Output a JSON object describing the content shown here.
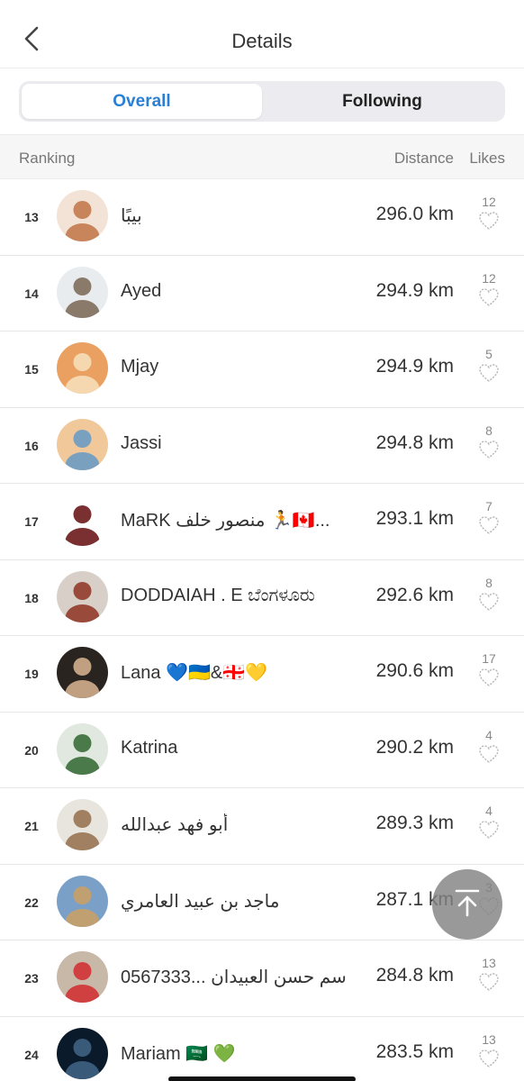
{
  "header": {
    "title": "Details",
    "back_icon": "chevron-left-icon"
  },
  "tabs": [
    {
      "label": "Overall",
      "active": true
    },
    {
      "label": "Following",
      "active": false
    }
  ],
  "columns": {
    "ranking": "Ranking",
    "distance": "Distance",
    "likes": "Likes"
  },
  "colors": {
    "accent": "#2a7fd4",
    "text": "#333333",
    "muted": "#888888"
  },
  "rows": [
    {
      "rank": "13",
      "name": "بيبًا",
      "distance": "296.0 km",
      "likes": "12"
    },
    {
      "rank": "14",
      "name": "Ayed",
      "distance": "294.9 km",
      "likes": "12"
    },
    {
      "rank": "15",
      "name": "Mjay",
      "distance": "294.9 km",
      "likes": "5"
    },
    {
      "rank": "16",
      "name": "Jassi",
      "distance": "294.8 km",
      "likes": "8"
    },
    {
      "rank": "17",
      "name": "MaRK منصور خلف 🏃🇨🇦...",
      "distance": "293.1 km",
      "likes": "7"
    },
    {
      "rank": "18",
      "name": "DODDAIAH . E ಬೆಂಗಳೂರು",
      "distance": "292.6 km",
      "likes": "8"
    },
    {
      "rank": "19",
      "name": "Lana 💙🇺🇦&🇬🇪💛",
      "distance": "290.6 km",
      "likes": "17"
    },
    {
      "rank": "20",
      "name": "Katrina",
      "distance": "290.2 km",
      "likes": "4"
    },
    {
      "rank": "21",
      "name": "أبو فهد عبدالله",
      "distance": "289.3 km",
      "likes": "4"
    },
    {
      "rank": "22",
      "name": "ماجد بن عبيد  العامري",
      "distance": "287.1 km",
      "likes": "3"
    },
    {
      "rank": "23",
      "name": "0567333... جاسم حسن العبيدان",
      "distance": "284.8 km",
      "likes": "13"
    },
    {
      "rank": "24",
      "name": "Mariam 🇸🇦 💚",
      "distance": "283.5 km",
      "likes": "13"
    }
  ],
  "scroll_top_icon": "arrow-up-to-top-icon"
}
